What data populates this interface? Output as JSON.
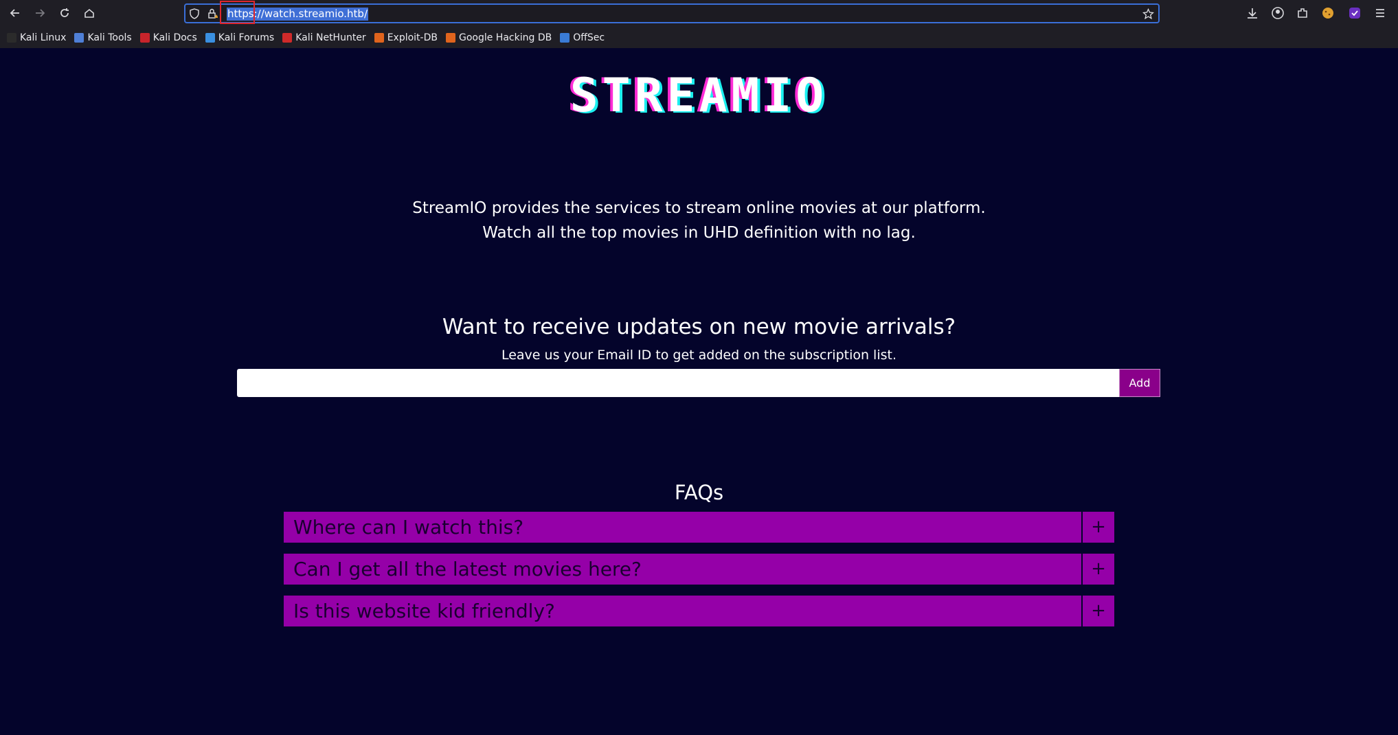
{
  "browser": {
    "url": "https://watch.streamio.htb/",
    "bookmarks": [
      {
        "label": "Kali Linux",
        "color": "#2b2b2b"
      },
      {
        "label": "Kali Tools",
        "color": "#4f7fd6"
      },
      {
        "label": "Kali Docs",
        "color": "#c8242b"
      },
      {
        "label": "Kali Forums",
        "color": "#3a8fe0"
      },
      {
        "label": "Kali NetHunter",
        "color": "#d02a2a"
      },
      {
        "label": "Exploit-DB",
        "color": "#e0641d"
      },
      {
        "label": "Google Hacking DB",
        "color": "#e0641d"
      },
      {
        "label": "OffSec",
        "color": "#3a7bd5"
      }
    ]
  },
  "page": {
    "logo": "STREAMIO",
    "description_line1": "StreamIO provides the services to stream online movies at our platform.",
    "description_line2": "Watch all the top movies in UHD definition with no lag.",
    "subscribe_heading": "Want to receive updates on new movie arrivals?",
    "subscribe_text": "Leave us your Email ID to get added on the subscription list.",
    "email_value": "",
    "add_label": "Add",
    "faq_title": "FAQs",
    "faqs": [
      {
        "question": "Where can I watch this?",
        "toggle": "+"
      },
      {
        "question": "Can I get all the latest movies here?",
        "toggle": "+"
      },
      {
        "question": "Is this website kid friendly?",
        "toggle": "+"
      }
    ]
  },
  "colors": {
    "background": "#04042b",
    "accent": "#9500a8",
    "button": "#8a008a",
    "url_highlight": "#e0262e"
  }
}
